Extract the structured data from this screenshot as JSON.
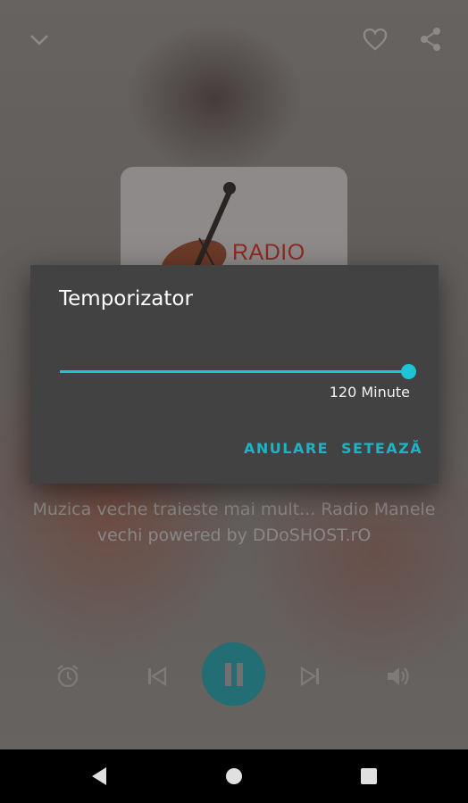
{
  "player": {
    "artwork_text": "RADIO",
    "subtitle_line1": "Muzica veche traieste mai mult... Radio Manele",
    "subtitle_line2": "vechi powered by DDoSHOST.rO"
  },
  "dialog": {
    "title": "Temporizator",
    "slider": {
      "value": 120,
      "max": 120,
      "fraction": 1.0
    },
    "value_label": "120 Minute",
    "cancel_label": "ANULARE",
    "confirm_label": "SETEAZĂ"
  },
  "colors": {
    "accent": "#1fc3d6",
    "play_button": "#236d74",
    "dialog_bg": "#424242"
  },
  "icons": {
    "top_left": "chevron-down-icon",
    "top_right": [
      "heart-icon",
      "share-icon"
    ],
    "controls": [
      "alarm-icon",
      "skip-previous-icon",
      "pause-icon",
      "skip-next-icon",
      "volume-icon"
    ],
    "nav": [
      "back-icon",
      "home-icon",
      "recents-icon"
    ]
  }
}
